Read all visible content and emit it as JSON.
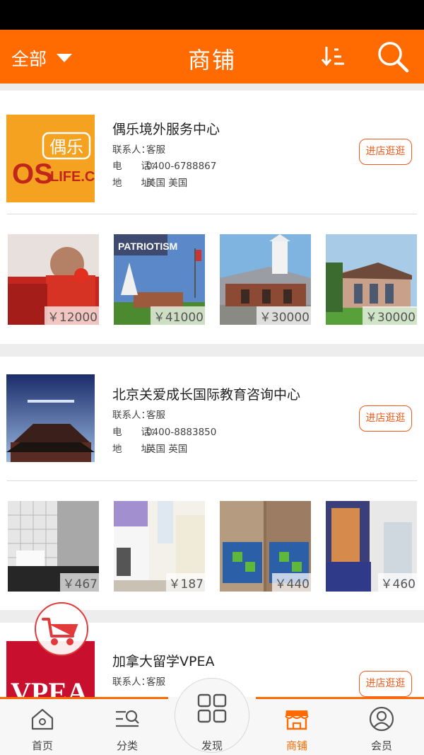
{
  "header": {
    "filter_label": "全部",
    "title": "商铺"
  },
  "shops": [
    {
      "name": "偶乐境外服务中心",
      "contact_key": "联系人：",
      "contact": "客服",
      "phone_key": "电　　话：",
      "phone": "0400-6788867",
      "address_key": "地　　址：",
      "address": "美国 美国",
      "visit_label": "进店逛逛",
      "logo_text_top": "偶乐",
      "logo_text_main": "OS",
      "logo_text_sub": "LIFE.CN",
      "products": [
        {
          "price": "￥12000"
        },
        {
          "price": "￥41000",
          "caption": "PATRIOTISM"
        },
        {
          "price": "￥30000"
        },
        {
          "price": "￥30000"
        }
      ]
    },
    {
      "name": "北京关爱成长国际教育咨询中心",
      "contact_key": "联系人：",
      "contact": "客服",
      "phone_key": "电　　话：",
      "phone": "0400-8883850",
      "address_key": "地　　址：",
      "address": "英国 英国",
      "visit_label": "进店逛逛",
      "products": [
        {
          "price": "￥467"
        },
        {
          "price": "￥187"
        },
        {
          "price": "￥440"
        },
        {
          "price": "￥460"
        }
      ]
    },
    {
      "name": "加拿大留学VPEA",
      "contact_key": "联系人：",
      "contact": "客服",
      "logo_text_main": "VPEA"
    }
  ],
  "tabs": [
    {
      "label": "首页",
      "icon": "home-icon"
    },
    {
      "label": "分类",
      "icon": "category-icon"
    },
    {
      "label": "发现",
      "icon": "grid-icon"
    },
    {
      "label": "商铺",
      "icon": "store-icon",
      "active": true
    },
    {
      "label": "会员",
      "icon": "user-icon"
    }
  ],
  "colors": {
    "accent": "#ff6b00",
    "visit_button": "#f05a1a",
    "cart": "#e23a3a"
  }
}
